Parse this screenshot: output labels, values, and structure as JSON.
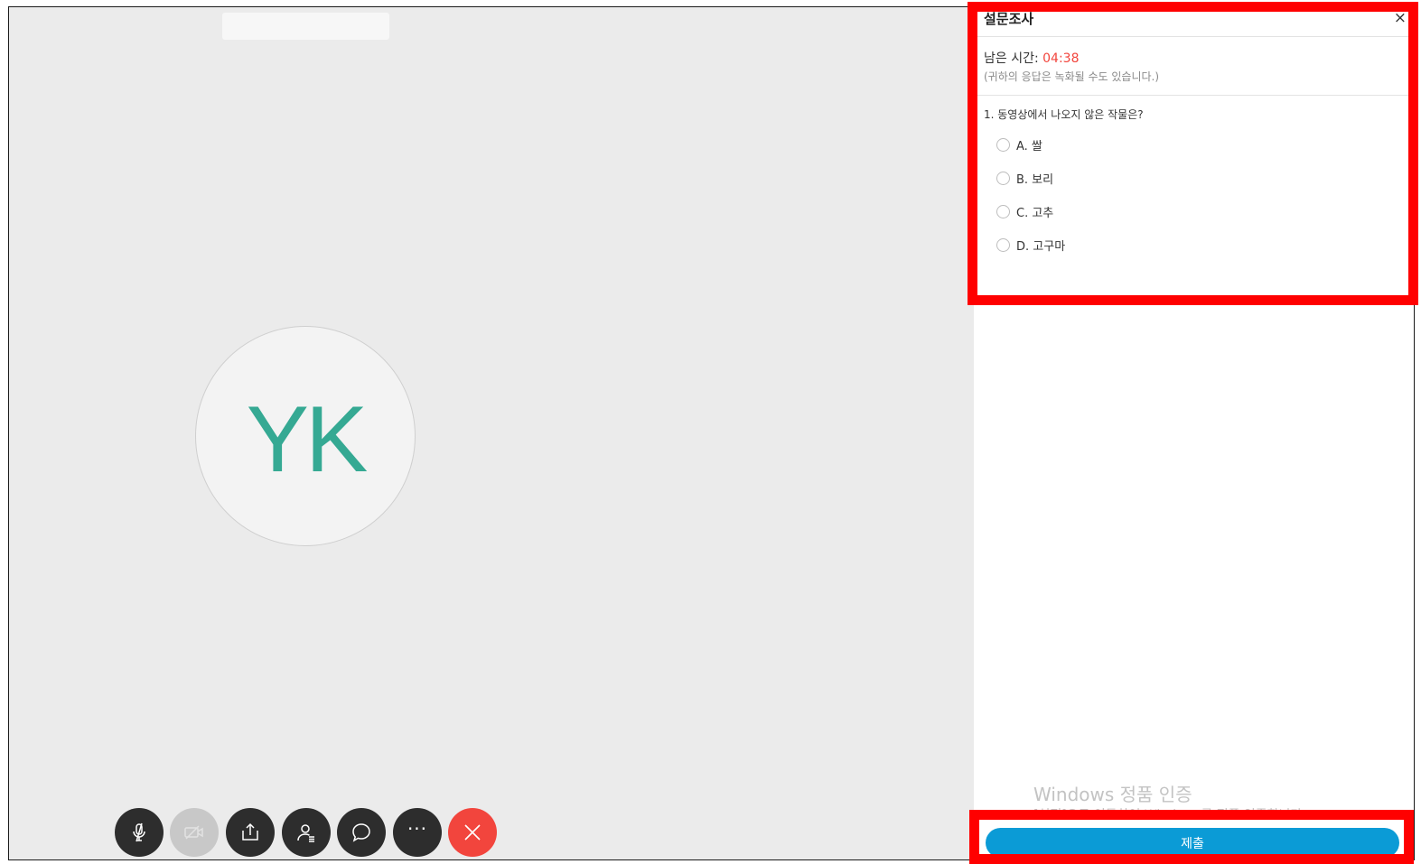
{
  "video": {
    "participant_initials": "YK",
    "initials_color": "#35a993"
  },
  "toolbar": {
    "buttons": [
      {
        "name": "mute-microphone",
        "icon": "microphone-off-icon",
        "state": "active"
      },
      {
        "name": "camera",
        "icon": "camera-off-icon",
        "state": "disabled"
      },
      {
        "name": "share-screen",
        "icon": "share-icon",
        "state": "active"
      },
      {
        "name": "participants",
        "icon": "participants-icon",
        "state": "active"
      },
      {
        "name": "chat",
        "icon": "chat-icon",
        "state": "active"
      },
      {
        "name": "more",
        "icon": "more-icon",
        "label": "···",
        "state": "active"
      },
      {
        "name": "leave-meeting",
        "icon": "close-icon",
        "state": "danger"
      }
    ],
    "end_color": "#f2453d"
  },
  "survey": {
    "title": "설문조사",
    "close_label": "×",
    "time_label": "남은 시간: ",
    "time_value": "04:38",
    "record_note": "(귀하의 응답은 녹화될 수도 있습니다.)",
    "question": "1. 동영상에서 나오지 않은 작물은?",
    "options": [
      "A. 쌀",
      "B. 보리",
      "C. 고추",
      "D. 고구마"
    ],
    "submit_label": "제출",
    "accent_color": "#0b9bd6"
  },
  "watermark": {
    "title": "Windows 정품 인증",
    "subtitle": "[설정]으로 이동하여 Windows를 정품 인증합니다."
  },
  "highlight_color": "#ff0000"
}
